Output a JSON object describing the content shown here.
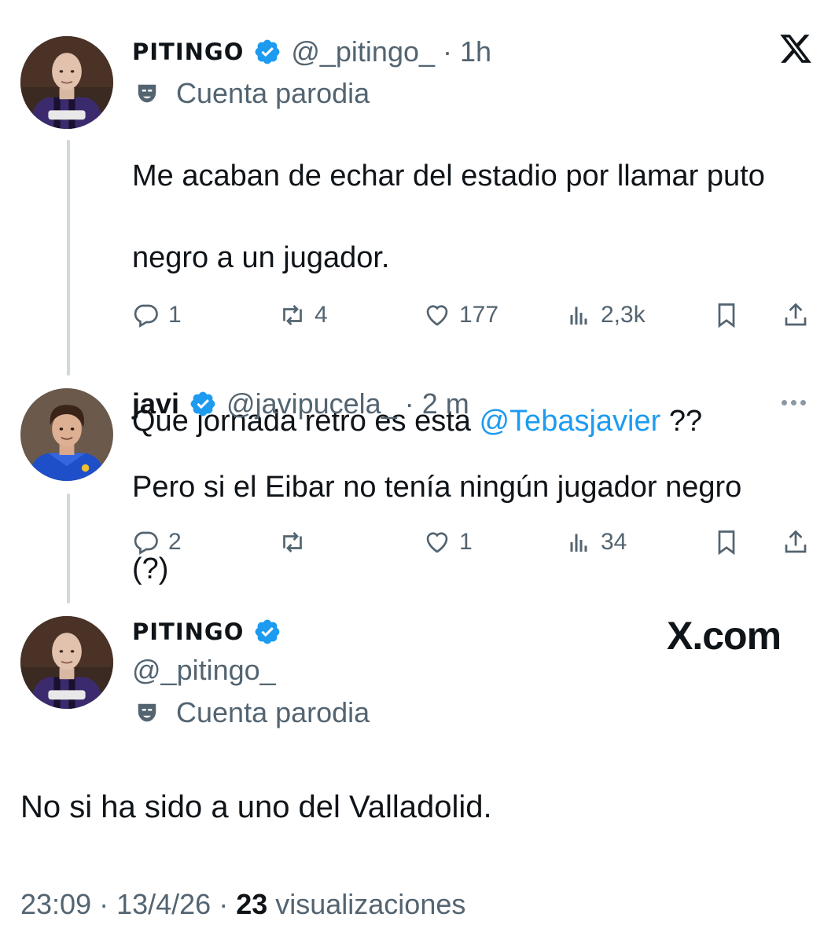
{
  "tweet1": {
    "name": "PITINGO",
    "handle_time": "@_pitingo_ · 1h",
    "parody_label": "Cuenta parodia",
    "text_line1": "Me acaban de echar del estadio por llamar puto",
    "text_line2": "negro a un jugador.",
    "text_line3_pre": "Que jornada retro es esta ",
    "mention": "@Tebasjavier",
    "text_line3_post": " ??",
    "actions": {
      "replies": "1",
      "reposts": "4",
      "likes": "177",
      "views": "2,3k"
    }
  },
  "tweet2": {
    "name": "javi",
    "handle_time": "@javipucela_ · 2 m",
    "text_line1": "Pero si el Eibar no tenía ningún jugador negro",
    "text_line2": "(?)",
    "actions": {
      "replies": "2",
      "reposts": "",
      "likes": "1",
      "views": "34"
    }
  },
  "tweet3": {
    "name": "PITINGO",
    "handle": "@_pitingo_",
    "parody_label": "Cuenta parodia",
    "watermark": "X.com",
    "text": "No si ha sido a uno del Valladolid.",
    "footer": {
      "time": "23:09 · 13/4/26 · ",
      "views_count": "23",
      "views_label": " visualizaciones"
    }
  },
  "colors": {
    "accent": "#1d9bf0",
    "secondary_text": "#536471",
    "primary_text": "#0f1419",
    "thread_line": "#cfd9de"
  },
  "icons": [
    "x-logo-icon",
    "verified-badge-icon",
    "parody-mask-icon",
    "reply-icon",
    "repost-icon",
    "like-icon",
    "views-icon",
    "bookmark-icon",
    "share-icon",
    "more-icon"
  ]
}
